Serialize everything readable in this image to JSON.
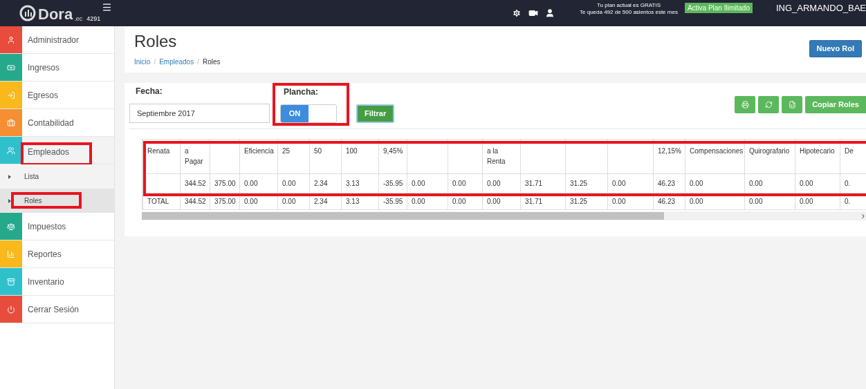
{
  "topbar": {
    "logo": "Dora",
    "logo_suffix": ".ec",
    "count": "4291",
    "plan_line_1": "Tu plan actual es GRATIS",
    "plan_line_2": "Te queda 492 de 500 asientos este mes",
    "upgrade_button": "Activa Plan Ilimitado",
    "user": "ING_ARMANDO_BAE"
  },
  "sidebar": {
    "items": [
      {
        "label": "Administrador",
        "color": "#e74c3c",
        "expanded": false,
        "highlighted": false
      },
      {
        "label": "Ingresos",
        "color": "#26a98a",
        "expanded": false,
        "highlighted": false
      },
      {
        "label": "Egresos",
        "color": "#f9b81b",
        "expanded": false,
        "highlighted": false
      },
      {
        "label": "Contabilidad",
        "color": "#f68e33",
        "expanded": false,
        "highlighted": false
      },
      {
        "label": "Empleados",
        "color": "#2ec1cc",
        "expanded": true,
        "highlighted": true,
        "children": [
          {
            "label": "Lista",
            "selected": false,
            "highlighted": false
          },
          {
            "label": "Roles",
            "selected": true,
            "highlighted": true
          }
        ]
      },
      {
        "label": "Impuestos",
        "color": "#26a98a",
        "expanded": false,
        "highlighted": false
      },
      {
        "label": "Reportes",
        "color": "#f9b81b",
        "expanded": false,
        "highlighted": false
      },
      {
        "label": "Inventario",
        "color": "#2ec1cc",
        "expanded": false,
        "highlighted": false
      },
      {
        "label": "Cerrar Sesión",
        "color": "#e74c3c",
        "expanded": false,
        "highlighted": false
      }
    ]
  },
  "page": {
    "title": "Roles",
    "breadcrumb": [
      "Inicio",
      "Empleados",
      "Roles"
    ],
    "breadcrumb_separator": "/",
    "new_button": "Nuevo Rol"
  },
  "filters": {
    "date_label": "Fecha:",
    "date_value": "Septiembre 2017",
    "plancha_label": "Plancha:",
    "plancha": {
      "on": true,
      "label": "ON",
      "highlighted": true
    },
    "filter_button": "Filtrar",
    "copy_button": "Copiar Roles"
  },
  "table": {
    "highlighted": true,
    "columns": [
      "Renata",
      "a\nPagar",
      "",
      "Eficiencia",
      "25",
      "50",
      "100",
      "9,45%",
      "",
      "",
      "a la\nRenta",
      "",
      "",
      "",
      "12,15%",
      "Compensaciones",
      "Quirografario",
      "Hipotecario",
      "De"
    ],
    "rows": [
      [
        "",
        "344.52",
        "375.00",
        "0.00",
        "0.00",
        "2.34",
        "3.13",
        "-35.95",
        "0.00",
        "0.00",
        "0.00",
        "31.71",
        "31.25",
        "0.00",
        "46.23",
        "0.00",
        "0.00",
        "0.00",
        "0."
      ],
      [
        "TOTAL",
        "344.52",
        "375.00",
        "0.00",
        "0.00",
        "2.34",
        "3.13",
        "-35.95",
        "0.00",
        "0.00",
        "0.00",
        "31.71",
        "31.25",
        "0.00",
        "46.23",
        "0.00",
        "0.00",
        "0.00",
        "0."
      ]
    ]
  }
}
